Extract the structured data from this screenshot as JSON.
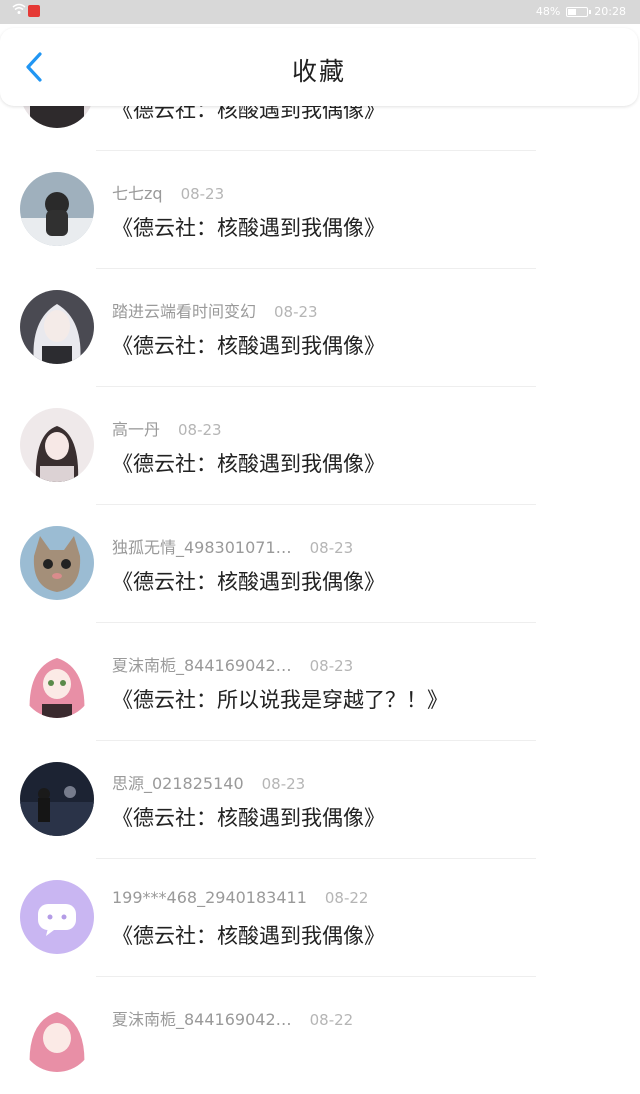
{
  "status": {
    "battery": "48%",
    "time": "20:28",
    "battery_level": 0.48
  },
  "header": {
    "title": "收藏"
  },
  "items": [
    {
      "name": "",
      "date": "",
      "message": "《德云社：核酸遇到我偶像》"
    },
    {
      "name": "七七zq",
      "date": "08-23",
      "message": "《德云社：核酸遇到我偶像》"
    },
    {
      "name": "踏进云端看时间变幻",
      "date": "08-23",
      "message": "《德云社：核酸遇到我偶像》"
    },
    {
      "name": "高一丹",
      "date": "08-23",
      "message": "《德云社：核酸遇到我偶像》"
    },
    {
      "name": "独孤无情_498301071…",
      "date": "08-23",
      "message": "《德云社：核酸遇到我偶像》"
    },
    {
      "name": "夏沫南栀_844169042…",
      "date": "08-23",
      "message": "《德云社：所以说我是穿越了？！》"
    },
    {
      "name": "思源_021825140",
      "date": "08-23",
      "message": "《德云社：核酸遇到我偶像》"
    },
    {
      "name": "199***468_2940183411",
      "date": "08-22",
      "message": "《德云社：核酸遇到我偶像》"
    },
    {
      "name": "夏沫南栀_844169042…",
      "date": "08-22",
      "message": ""
    }
  ],
  "colors": {
    "accent": "#2196f3",
    "statusbar": "#d8d8d8",
    "purple_avatar": "#c9b6f2"
  }
}
